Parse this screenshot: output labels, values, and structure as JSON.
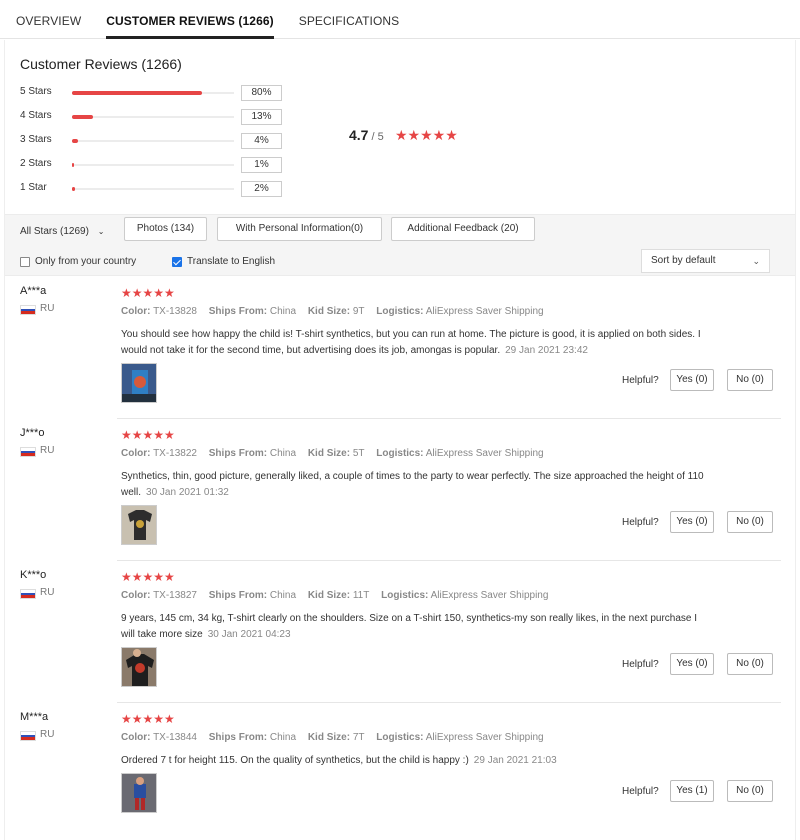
{
  "tabs": [
    {
      "label": "OVERVIEW",
      "active": false
    },
    {
      "label": "CUSTOMER REVIEWS (1266)",
      "active": true
    },
    {
      "label": "SPECIFICATIONS",
      "active": false
    }
  ],
  "summary": {
    "title": "Customer Reviews (1266)",
    "breakdown": [
      {
        "label": "5 Stars",
        "percent": "80%",
        "fraction": 0.8
      },
      {
        "label": "4 Stars",
        "percent": "13%",
        "fraction": 0.13
      },
      {
        "label": "3 Stars",
        "percent": "4%",
        "fraction": 0.04
      },
      {
        "label": "2 Stars",
        "percent": "1%",
        "fraction": 0.01
      },
      {
        "label": "1 Star",
        "percent": "2%",
        "fraction": 0.02
      }
    ],
    "average": "4.7",
    "average_of": "/ 5",
    "star_color": "#e64545"
  },
  "filters": {
    "all_stars": "All Stars (1269)",
    "buttons": [
      "Photos (134)",
      "With Personal Information(0)",
      "Additional Feedback (20)"
    ],
    "only_country": "Only from your country",
    "only_country_checked": false,
    "translate": "Translate to English",
    "translate_checked": true,
    "sort": "Sort by default"
  },
  "labels": {
    "color": "Color:",
    "ships_from": "Ships From:",
    "kid_size": "Kid Size:",
    "logistics": "Logistics:",
    "helpful": "Helpful?"
  },
  "reviews": [
    {
      "name": "A***a",
      "country": "RU",
      "color": "TX-13828",
      "ships_from": "China",
      "kid_size": "9T",
      "logistics": "AliExpress Saver Shipping",
      "text": "You should see how happy the child is! T-shirt synthetics, but you can run at home. The picture is good, it is applied on both sides. I would not take it for the second time, but advertising does its job, amongas is popular.",
      "date": "29 Jan 2021 23:42",
      "yes": "Yes (0)",
      "no": "No (0)"
    },
    {
      "name": "J***o",
      "country": "RU",
      "color": "TX-13822",
      "ships_from": "China",
      "kid_size": "5T",
      "logistics": "AliExpress Saver Shipping",
      "text": "Synthetics, thin, good picture, generally liked, a couple of times to the party to wear perfectly. The size approached the height of 110 well.",
      "date": "30 Jan 2021 01:32",
      "yes": "Yes (0)",
      "no": "No (0)"
    },
    {
      "name": "K***o",
      "country": "RU",
      "color": "TX-13827",
      "ships_from": "China",
      "kid_size": "11T",
      "logistics": "AliExpress Saver Shipping",
      "text": "9 years, 145 cm, 34 kg, T-shirt clearly on the shoulders. Size on a T-shirt 150, synthetics-my son really likes, in the next purchase I will take more size",
      "date": "30 Jan 2021 04:23",
      "yes": "Yes (0)",
      "no": "No (0)"
    },
    {
      "name": "M***a",
      "country": "RU",
      "color": "TX-13844",
      "ships_from": "China",
      "kid_size": "7T",
      "logistics": "AliExpress Saver Shipping",
      "text": "Ordered 7 t for height 115. On the quality of synthetics, but the child is happy :)",
      "date": "29 Jan 2021 21:03",
      "yes": "Yes (1)",
      "no": "No (0)"
    }
  ]
}
